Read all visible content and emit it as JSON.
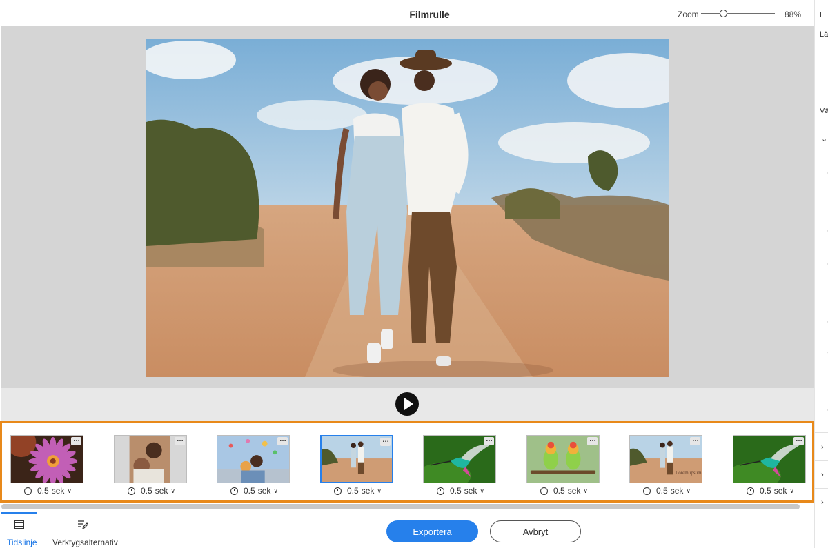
{
  "header": {
    "title": "Filmrulle",
    "zoom_label": "Zoom",
    "zoom_value": "88%",
    "zoom_fraction": 0.3
  },
  "preview": {
    "image": "photo-couple-walking-dirt-road"
  },
  "filmstrip": {
    "slides": [
      {
        "thumb": "purple-daisy-flower",
        "duration": "0.5",
        "unit": "sek",
        "selected": false
      },
      {
        "thumb": "man-hugging-portrait",
        "duration": "0.5",
        "unit": "sek",
        "selected": false
      },
      {
        "thumb": "couple-with-balloons",
        "duration": "0.5",
        "unit": "sek",
        "selected": false
      },
      {
        "thumb": "couple-walking-road",
        "duration": "0.5",
        "unit": "sek",
        "selected": true
      },
      {
        "thumb": "hummingbird-green",
        "duration": "0.5",
        "unit": "sek",
        "selected": false
      },
      {
        "thumb": "two-lovebird-parrots",
        "duration": "0.5",
        "unit": "sek",
        "selected": false
      },
      {
        "thumb": "couple-walking-road-with-text",
        "duration": "0.5",
        "unit": "sek",
        "selected": false,
        "caption": "Lorem ipsum"
      },
      {
        "thumb": "hummingbird-green",
        "duration": "0.5",
        "unit": "sek",
        "selected": false
      }
    ]
  },
  "right_panel": {
    "label_1": "L",
    "label_2": "Läg",
    "label_3": "Vä"
  },
  "bottom": {
    "tab_timeline": "Tidslinje",
    "tab_tools": "Verktygsalternativ",
    "export_label": "Exportera",
    "cancel_label": "Avbryt"
  },
  "colors": {
    "accent": "#2680eb",
    "highlight_border": "#e8891a"
  }
}
